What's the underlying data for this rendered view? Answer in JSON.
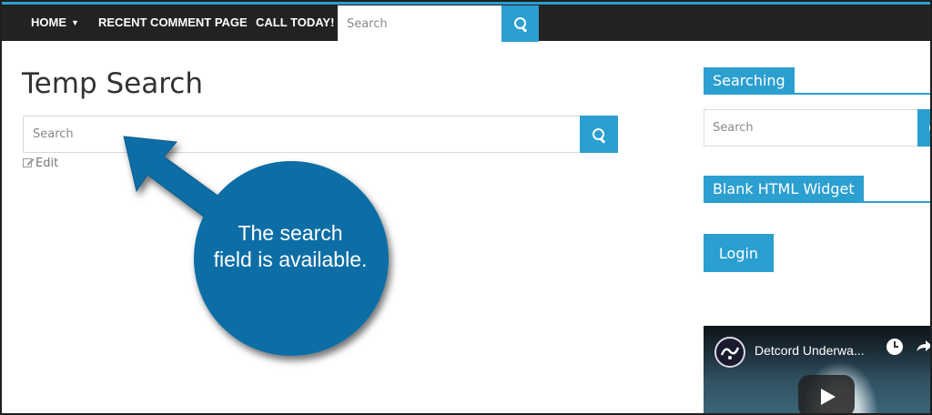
{
  "nav": {
    "items": [
      {
        "label": "HOME"
      },
      {
        "label": "RECENT COMMENT PAGE"
      },
      {
        "label": "CALL TODAY!"
      }
    ],
    "search_placeholder": "Search"
  },
  "main": {
    "title": "Temp Search",
    "search_placeholder": "Search",
    "edit_label": "Edit"
  },
  "callout": {
    "line1": "The search",
    "line2": "field is available.",
    "color": "#0e6ea5"
  },
  "sidebar": {
    "searching_title": "Searching",
    "search_placeholder": "Search",
    "blank_title": "Blank HTML Widget",
    "login_label": "Login"
  },
  "video": {
    "title": "Detcord Underwa..."
  },
  "colors": {
    "accent": "#2b9fd0",
    "nav_bg": "#222222"
  }
}
